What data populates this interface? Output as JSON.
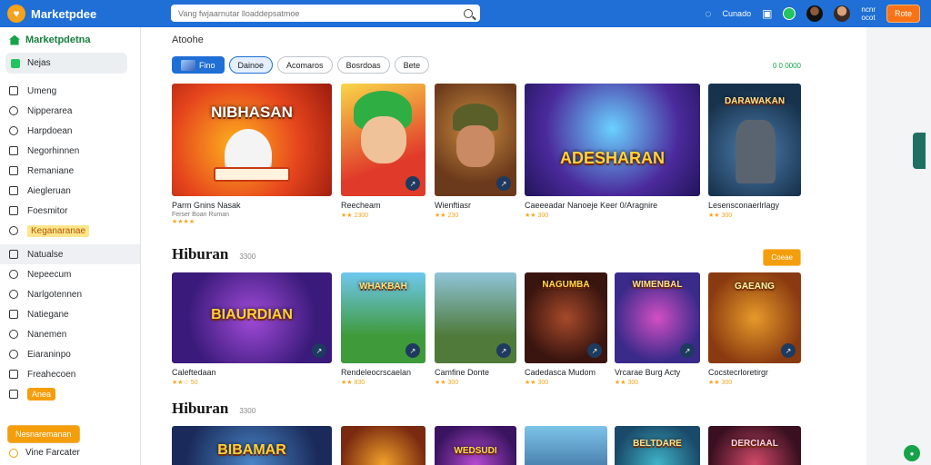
{
  "header": {
    "brand": "Marketpdee",
    "search_placeholder": "Vang fwjaarnutar lloaddepsatmoe",
    "link_label": "Cunado",
    "user_label_line1": "ncnr",
    "user_label_line2": "ocot",
    "action_button": "Rote"
  },
  "sidebar": {
    "title": "Marketpdetna",
    "active_item": "Nejas",
    "items": [
      "Umeng",
      "Nipperarea",
      "Harpdoean",
      "Negorhinnen",
      "Remaniane",
      "Aiegleruan",
      "Foesmitor",
      "Keganaranae",
      "Natualse",
      "Nepeecum",
      "Narlgotennen",
      "Natiegane",
      "Nanemen",
      "Eiaraninpo",
      "Freahecoen",
      "Anea"
    ],
    "cta_label": "Nesnaremanan",
    "footer_label": "Vine Farcater"
  },
  "main": {
    "breadcrumb": "Atoohe",
    "filters": [
      "Fino",
      "Dainoe",
      "Acomaros",
      "Bosrdoas",
      "Bete"
    ],
    "active_filter_index": 1,
    "status_dots": "0 0 0000",
    "sections": [
      {
        "title": "",
        "count": "",
        "cards": [
          {
            "title": "Parm Gnins Nasak",
            "sub": "Ferser Boan Ruman",
            "rating": "★★★★",
            "thumb_text": "NIBHASAN"
          },
          {
            "title": "Reecheam",
            "sub": "★★ 2300",
            "rating": "",
            "thumb_text": ""
          },
          {
            "title": "Wienftiasr",
            "sub": "★★ 230",
            "rating": "",
            "thumb_text": ""
          },
          {
            "title": "Caeeeadar Nanoeje Keer 0/Aragnire",
            "sub": "★★ 300",
            "rating": "",
            "thumb_text": "ADESHARAN"
          },
          {
            "title": "Lesensconaerlrlagy",
            "sub": "★★ 300",
            "rating": "",
            "thumb_text": "DARAWAKAN"
          }
        ]
      },
      {
        "title": "Hiburan",
        "count": "3300",
        "see_all": "Coeae",
        "cards": [
          {
            "title": "Caleftedaan",
            "sub": "★★☆ 50",
            "rating": "",
            "thumb_text": "BIAURDIAN"
          },
          {
            "title": "Rendeleocrscaelan",
            "sub": "★★ 830",
            "rating": "",
            "thumb_text": "WHAKBAH"
          },
          {
            "title": "Camfine Donte",
            "sub": "★★ 300",
            "rating": "",
            "thumb_text": ""
          },
          {
            "title": "Cadedasca Mudom",
            "sub": "★★ 300",
            "rating": "",
            "thumb_text": "NAGUMBA"
          },
          {
            "title": "Vrcarae Burg Acty",
            "sub": "★★ 300",
            "rating": "",
            "thumb_text": "WIMENBAL"
          },
          {
            "title": "Cocstecrloretirgr",
            "sub": "★★ 300",
            "rating": "",
            "thumb_text": "GAEANG"
          }
        ]
      },
      {
        "title": "Hiburan",
        "count": "3300",
        "cards": [
          {
            "title": "",
            "sub": "",
            "rating": "",
            "thumb_text": "BIBAMAR"
          },
          {
            "title": "",
            "sub": "",
            "rating": "",
            "thumb_text": ""
          },
          {
            "title": "",
            "sub": "",
            "rating": "",
            "thumb_text": "WEDSUDI"
          },
          {
            "title": "",
            "sub": "",
            "rating": "",
            "thumb_text": ""
          },
          {
            "title": "",
            "sub": "",
            "rating": "",
            "thumb_text": "BELTDARE"
          },
          {
            "title": "",
            "sub": "",
            "rating": "",
            "thumb_text": "DERCIAAL"
          }
        ]
      }
    ]
  },
  "colors": {
    "topbar": "#1f6fd6",
    "accent_orange": "#f97316",
    "accent_green": "#16a34a"
  },
  "icons": {
    "brand": "heart-icon",
    "search": "search-icon",
    "home": "home-icon"
  }
}
